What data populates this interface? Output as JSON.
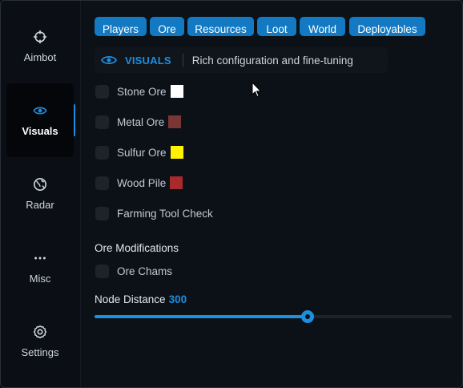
{
  "sidebar": {
    "items": [
      {
        "label": "Aimbot",
        "icon": "crosshair-icon"
      },
      {
        "label": "Visuals",
        "icon": "eye-icon"
      },
      {
        "label": "Radar",
        "icon": "globe-icon"
      },
      {
        "label": "Misc",
        "icon": "dots-icon"
      },
      {
        "label": "Settings",
        "icon": "gear-icon"
      }
    ],
    "active": "Visuals"
  },
  "tabs": [
    "Players",
    "Ore",
    "Resources",
    "Loot",
    "World",
    "Deployables"
  ],
  "header": {
    "title": "VISUALS",
    "description": "Rich configuration and fine-tuning"
  },
  "options": [
    {
      "label": "Stone Ore",
      "checked": false,
      "swatch": "#ffffff"
    },
    {
      "label": "Metal Ore",
      "checked": false,
      "swatch": "#7a3535"
    },
    {
      "label": "Sulfur Ore",
      "checked": false,
      "swatch": "#fff200"
    },
    {
      "label": "Wood Pile",
      "checked": false,
      "swatch": "#a82a2a"
    },
    {
      "label": "Farming Tool Check",
      "checked": false
    }
  ],
  "ore_modifications": {
    "title": "Ore Modifications",
    "options": [
      {
        "label": "Ore Chams",
        "checked": false
      }
    ]
  },
  "node_distance": {
    "label": "Node Distance",
    "value": "300",
    "fraction": 0.596
  },
  "colors": {
    "accent": "#1c8fe0",
    "tab_bg": "#1279c2",
    "background": "#0c1017"
  }
}
